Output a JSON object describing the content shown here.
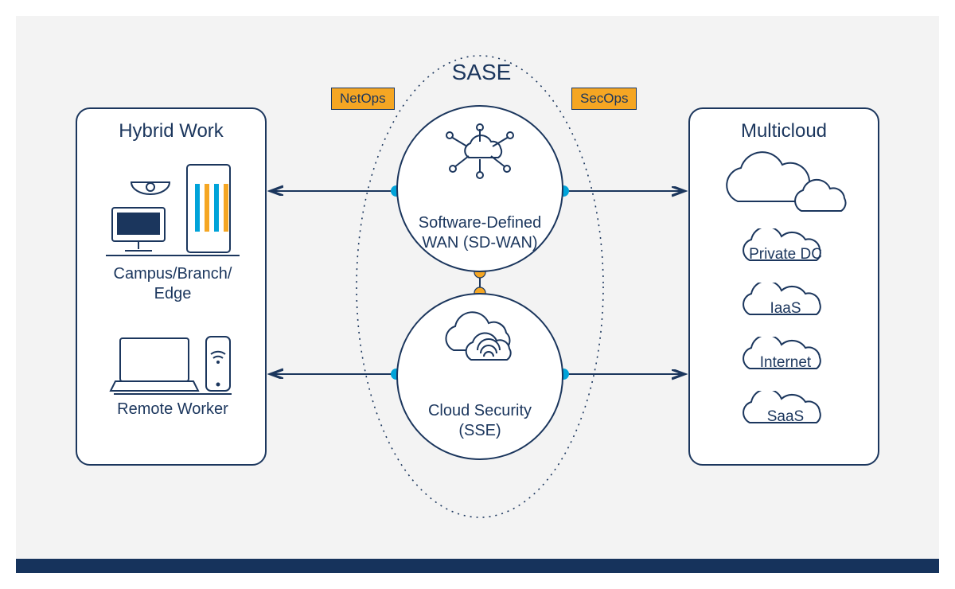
{
  "title": "SASE",
  "badges": {
    "left": "NetOps",
    "right": "SecOps"
  },
  "left_box": {
    "title": "Hybrid Work",
    "group1": "Campus/Branch/\nEdge",
    "group2": "Remote Worker"
  },
  "right_box": {
    "title": "Multicloud",
    "clouds": [
      "Private DC",
      "IaaS",
      "Internet",
      "SaaS"
    ]
  },
  "center": {
    "top": "Software-Defined\nWAN (SD-WAN)",
    "bottom": "Cloud Security\n(SSE)"
  },
  "colors": {
    "stroke": "#1b365d",
    "accent_blue": "#00a3d9",
    "accent_orange": "#f5a623"
  }
}
